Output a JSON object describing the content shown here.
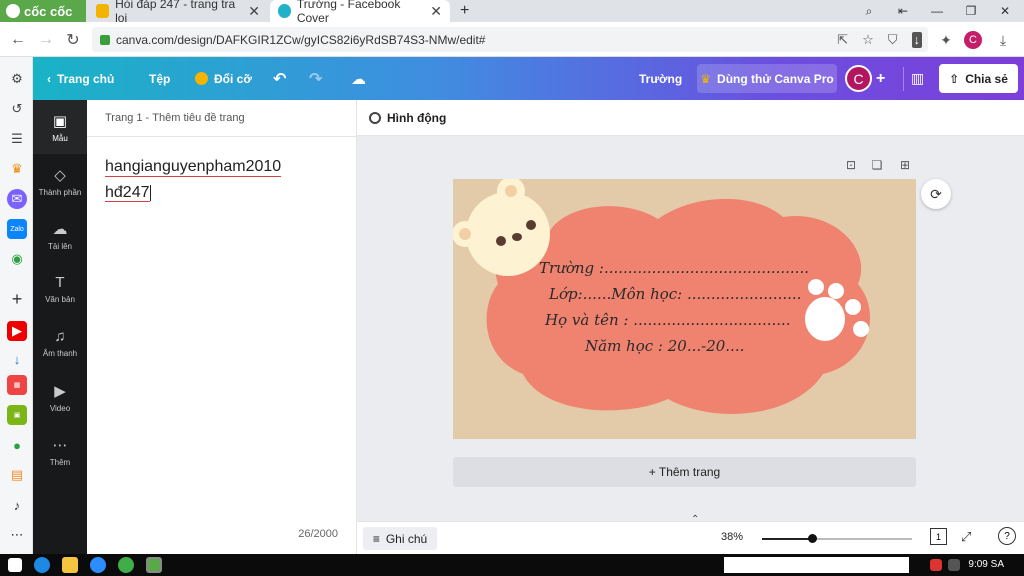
{
  "browser": {
    "brand": "cốc cốc",
    "tabs": [
      {
        "title": "Hỏi đáp 247 - trang tra loi",
        "active": false
      },
      {
        "title": "Trường - Facebook Cover",
        "active": true
      }
    ],
    "new_tab": "+",
    "url": "canva.com/design/DAFKGIR1ZCw/gyICS82i6yRdSB74S3-NMw/edit#",
    "profile_initial": "C"
  },
  "canva_header": {
    "home": "Trang chủ",
    "file": "Tệp",
    "resize": "Đổi cỡ",
    "design_title": "Trường",
    "try_pro": "Dùng thử Canva Pro",
    "avatar": "C",
    "share": "Chia sẻ"
  },
  "rail": [
    {
      "label": "Mẫu",
      "icon": "template-icon"
    },
    {
      "label": "Thành phần",
      "icon": "elements-icon"
    },
    {
      "label": "Tải lên",
      "icon": "upload-icon"
    },
    {
      "label": "Văn bản",
      "icon": "text-icon"
    },
    {
      "label": "Âm thanh",
      "icon": "music-icon"
    },
    {
      "label": "Video",
      "icon": "video-icon"
    },
    {
      "label": "Thêm",
      "icon": "more-icon"
    }
  ],
  "panel": {
    "page_label": "Trang 1 - ",
    "page_title_placeholder": "Thêm tiêu đề trang",
    "note_line1": "hangianguyenpham2010",
    "note_line2": "hđ247",
    "counter": "26/2000"
  },
  "editor": {
    "animate": "Hình động",
    "add_page": "+ Thêm trang",
    "notes": "Ghi chú",
    "zoom": "38%"
  },
  "card": {
    "line1": "Trường :...........................................",
    "line2": "Lớp:......Môn học: ........................",
    "line3": "Họ và tên : .................................",
    "line4": "Năm học : 20...-20...."
  },
  "taskbar": {
    "clock": "9:09 SA"
  }
}
